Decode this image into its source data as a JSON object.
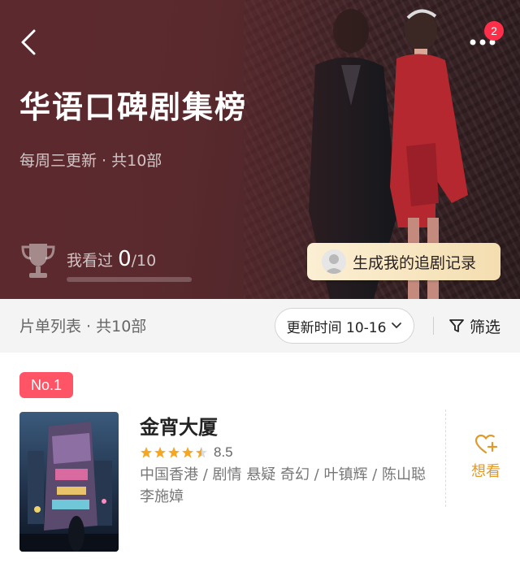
{
  "header": {
    "title": "华语口碑剧集榜",
    "subtitle": "每周三更新 · 共10部",
    "notification_count": "2",
    "watched_label": "我看过",
    "watched_count": "0",
    "watched_total": "/10",
    "watched_progress": 0,
    "generate_button_label": "生成我的追剧记录"
  },
  "list_header": {
    "count_label": "片单列表 · 共10部",
    "sort_label": "更新时间 10-16",
    "filter_label": "筛选"
  },
  "items": [
    {
      "rank": "No.1",
      "title": "金宵大厦",
      "rating": "8.5",
      "stars": 4.5,
      "meta": "中国香港 / 剧情 悬疑 奇幻 / 叶镇辉 / 陈山聪 李施嫜",
      "want_label": "想看"
    }
  ],
  "colors": {
    "accent": "#ff5366",
    "star": "#f5a623",
    "want": "#e19a2a",
    "hero_bg": "#5e2b2f"
  },
  "icons": {
    "back": "back-chevron-icon",
    "more": "more-dots-icon",
    "trophy": "trophy-icon",
    "avatar": "user-avatar-icon",
    "caret": "chevron-down-icon",
    "filter": "funnel-icon",
    "want": "heart-plus-icon"
  }
}
